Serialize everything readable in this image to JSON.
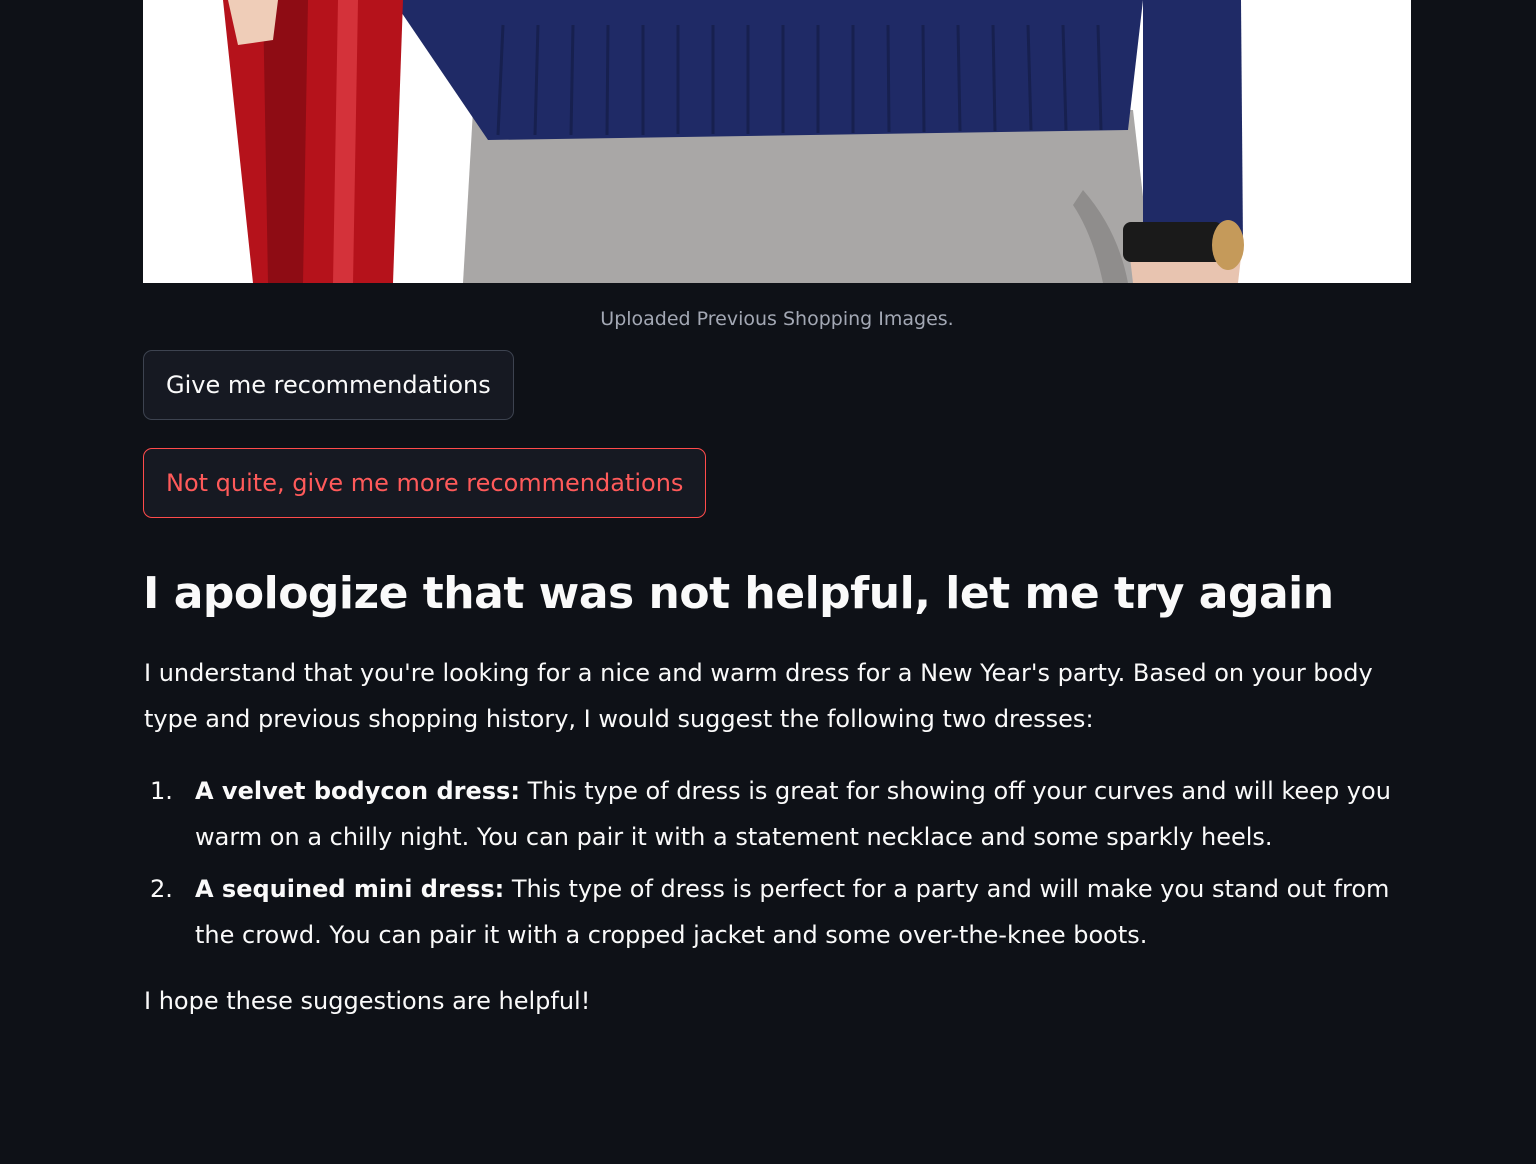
{
  "upload": {
    "caption": "Uploaded Previous Shopping Images."
  },
  "buttons": {
    "recommend_label": "Give me recommendations",
    "more_label": "Not quite, give me more recommendations"
  },
  "response": {
    "heading": "I apologize that was not helpful, let me try again",
    "intro": "I understand that you're looking for a nice and warm dress for a New Year's party. Based on your body type and previous shopping history, I would suggest the following two dresses:",
    "items": [
      {
        "number": "1.",
        "title": "A velvet bodycon dress:",
        "text": " This type of dress is great for showing off your curves and will keep you warm on a chilly night. You can pair it with a statement necklace and some sparkly heels."
      },
      {
        "number": "2.",
        "title": "A sequined mini dress:",
        "text": " This type of dress is perfect for a party and will make you stand out from the crowd. You can pair it with a cropped jacket and some over-the-knee boots."
      }
    ],
    "closing": "I hope these suggestions are helpful!"
  },
  "colors": {
    "background": "#0e1117",
    "text": "#fafafa",
    "caption": "#a3a8b4",
    "danger": "#ff4b4b",
    "sweater": "#1f2a66",
    "skirt": "#a9a7a6",
    "bag": "#b5121b"
  }
}
